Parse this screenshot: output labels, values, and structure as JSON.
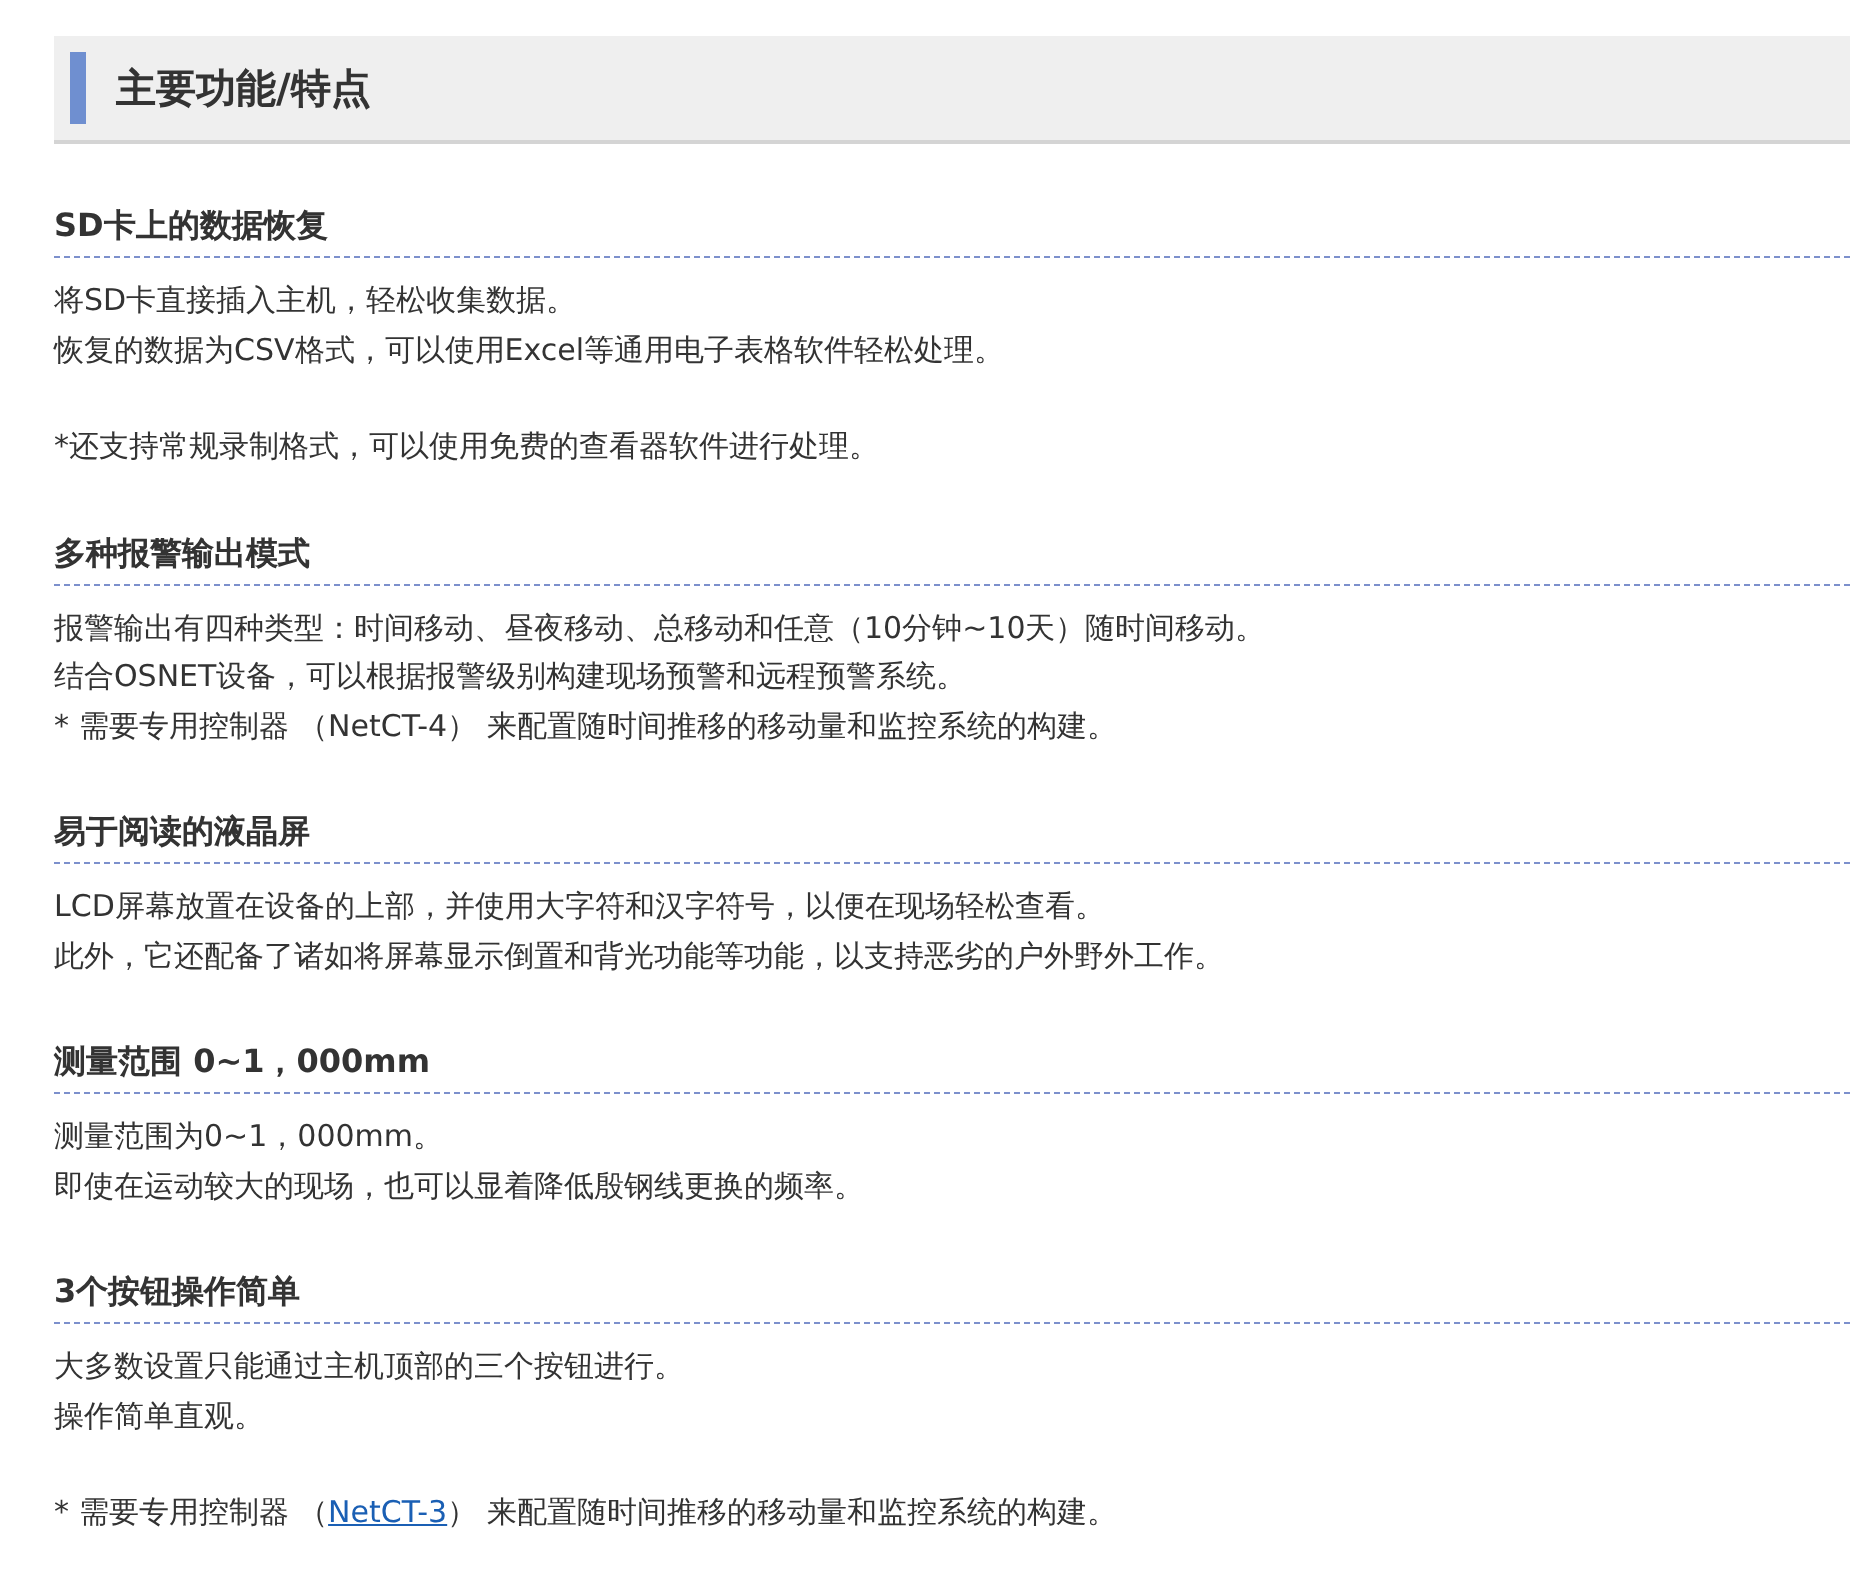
{
  "title": "主要功能/特点",
  "sections": [
    {
      "heading": "SD卡上的数据恢复",
      "paragraphs": [
        {
          "kind": "text",
          "lines": [
            "将SD卡直接插入主机，轻松收集数据。",
            "恢复的数据为CSV格式，可以使用Excel等通用电子表格软件轻松处理。"
          ]
        },
        {
          "kind": "text",
          "lines": [
            "*还支持常规录制格式，可以使用免费的查看器软件进行处理。"
          ]
        }
      ]
    },
    {
      "heading": "多种报警输出模式",
      "paragraphs": [
        {
          "kind": "text",
          "lines": [
            "报警输出有四种类型：时间移动、昼夜移动、总移动和任意（10分钟~10天）随时间移动。",
            "结合OSNET设备，可以根据报警级别构建现场预警和远程预警系统。",
            "* 需要专用控制器 （NetCT-4） 来配置随时间推移的移动量和监控系统的构建。"
          ]
        }
      ]
    },
    {
      "heading": "易于阅读的液晶屏",
      "paragraphs": [
        {
          "kind": "text",
          "lines": [
            "LCD屏幕放置在设备的上部，并使用大字符和汉字符号，以便在现场轻松查看。",
            "此外，它还配备了诸如将屏幕显示倒置和背光功能等功能，以支持恶劣的户外野外工作。"
          ]
        }
      ]
    },
    {
      "heading": "测量范围 0~1，000mm",
      "paragraphs": [
        {
          "kind": "text",
          "lines": [
            "测量范围为0~1，000mm。",
            "即使在运动较大的现场，也可以显着降低殷钢线更换的频率。"
          ]
        }
      ]
    },
    {
      "heading": "3个按钮操作简单",
      "paragraphs": [
        {
          "kind": "text",
          "lines": [
            "大多数设置只能通过主机顶部的三个按钮进行。",
            "操作简单直观。"
          ]
        },
        {
          "kind": "link",
          "before": "* 需要专用控制器 （",
          "link": "NetCT-3",
          "after": "） 来配置随时间推移的移动量和监控系统的构建。"
        }
      ]
    }
  ]
}
